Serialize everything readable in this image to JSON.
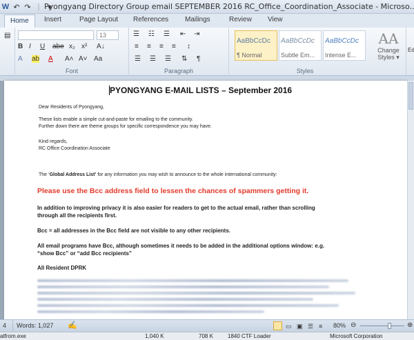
{
  "window": {
    "title": "Pyongyang Directory Group email SEPTEMBER 2016 RC_Office_Coordination_Associate - Microso..."
  },
  "qat": [
    "W",
    "↶",
    "↷",
    "|",
    "▾"
  ],
  "tabs": [
    "Home",
    "Insert",
    "Page Layout",
    "References",
    "Mailings",
    "Review",
    "View"
  ],
  "ribbon": {
    "font_size": "13",
    "groups": {
      "font": "Font",
      "paragraph": "Paragraph",
      "styles": "Styles",
      "editing": "Ed"
    },
    "font_buttons": [
      "B",
      "I",
      "U",
      "abe",
      "x₂",
      "x²",
      "A↓"
    ],
    "font_buttons2": [
      "A",
      "ab",
      "A",
      "A˄",
      "A˅",
      "Aa"
    ],
    "para_buttons": [
      "≡",
      "≡",
      "≡",
      "≡",
      "↕"
    ],
    "para_buttons2": [
      "☰",
      "☰",
      "☰",
      "⇅",
      "¶"
    ],
    "styles": [
      {
        "sample": "AaBbCcDc",
        "name": "¶ Normal"
      },
      {
        "sample": "AaBbCcDc",
        "name": "Subtle Em..."
      },
      {
        "sample": "AaBbCcDc",
        "name": "Intense E..."
      }
    ],
    "change_styles": {
      "icon": "AA",
      "label1": "Change",
      "label2": "Styles ▾"
    }
  },
  "document": {
    "title": "PYONGYANG E-MAIL LISTS – September 2016",
    "greeting": "Dear Residents of Pyongyang,",
    "intro1": "These lists enable a simple cut-and-paste for emailing to the community.",
    "intro2": "Further down there are theme groups for specific correspondence you may have.",
    "regards": "Kind regards,",
    "signature": "RC Office Coordination Associate",
    "gal_prefix": "The ‘",
    "gal_name": "Global Address List’",
    "gal_suffix": " for any information you may wish to announce to the whole international community:",
    "bcc_warning": "Please use the Bcc address field to lessen the chances of spammers getting it.",
    "privacy1": "In addition to improving privacy it is also easier for readers to get to the actual email, rather than scrolling",
    "privacy2": "through all the recipients first.",
    "bcc_note": "Bcc = all addresses in the Bcc field are not visible to any other recipients.",
    "programs1": "All email programs have Bcc, although sometimes it needs to be added in the additional options window: e.g.",
    "programs2": "“show Bcc” or “add Bcc recipients”",
    "section": "All Resident DPRK"
  },
  "status": {
    "page": "4",
    "words": "Words: 1,027",
    "zoom": "80%"
  },
  "taskbar": {
    "process": "atfrom.exe",
    "mem1": "1,040 K",
    "mem2": "708 K",
    "pid_desc": "1840 CTF Loader",
    "company": "Microsoft Corporation"
  }
}
